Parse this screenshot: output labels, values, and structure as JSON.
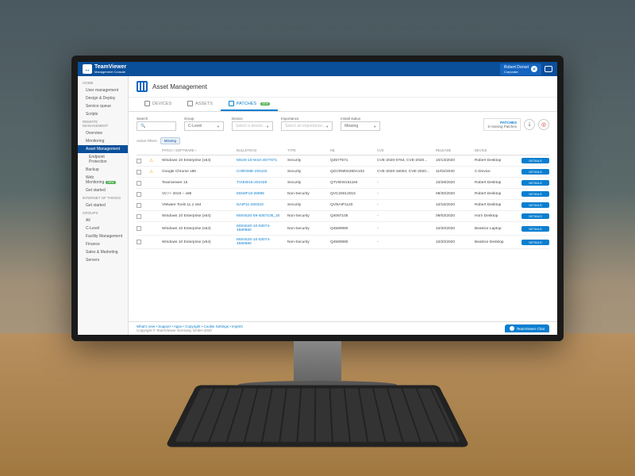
{
  "brand": {
    "name": "TeamViewer",
    "subtitle": "Management Console",
    "logo_glyph": "↔"
  },
  "user": {
    "name": "Robert Dorset",
    "tier": "Corporate"
  },
  "sidebar": {
    "sections": [
      {
        "title": "HOME",
        "items": [
          {
            "label": "User management"
          },
          {
            "label": "Design & Deploy"
          },
          {
            "label": "Service queue"
          },
          {
            "label": "Scripts"
          }
        ]
      },
      {
        "title": "REMOTE MANAGEMENT",
        "items": [
          {
            "label": "Overview"
          },
          {
            "label": "Monitoring"
          },
          {
            "label": "Asset Management",
            "active": true
          },
          {
            "label": "Endpoint Protection",
            "sub": true
          },
          {
            "label": "Backup"
          },
          {
            "label": "Web Monitoring",
            "badge": "NEW"
          },
          {
            "label": "Get started"
          }
        ]
      },
      {
        "title": "INTERNET OF THINGS",
        "items": [
          {
            "label": "Get started"
          }
        ]
      },
      {
        "title": "GROUPS",
        "items": [
          {
            "label": "All"
          },
          {
            "label": "C-Level"
          },
          {
            "label": "Facility Management"
          },
          {
            "label": "Finance"
          },
          {
            "label": "Sales & Marketing"
          },
          {
            "label": "Servers"
          }
        ]
      }
    ]
  },
  "page": {
    "title": "Asset Management"
  },
  "tabs": [
    {
      "label": "DEVICES"
    },
    {
      "label": "ASSETS"
    },
    {
      "label": "PATCHES",
      "active": true,
      "badge": "NEW"
    }
  ],
  "filters": {
    "search": {
      "label": "Search",
      "placeholder": ""
    },
    "group": {
      "label": "Group",
      "value": "C-Level"
    },
    "device": {
      "label": "Device",
      "placeholder": "Select a device..."
    },
    "importance": {
      "label": "Importance",
      "placeholder": "Select an importance..."
    },
    "install": {
      "label": "Install status",
      "value": "Missing"
    }
  },
  "patches_summary": {
    "title": "PATCHES",
    "text": "8 missing Patches"
  },
  "active_filters": {
    "label": "Active Filters",
    "chip": "Missing"
  },
  "columns": [
    "",
    "",
    "PATCH / SOFTWARE",
    "BULLETIN ID",
    "TYPE",
    "KB",
    "CVE",
    "RELEASE",
    "DEVICE",
    ""
  ],
  "sort_indicator": "↑",
  "details_label": "DETAILS",
  "rows": [
    {
      "warn": true,
      "patch": "Windows 10 Enterprise (x64)",
      "bulletin": "MS20-10-W10-4577671",
      "type": "Security",
      "kb": "Q4577671",
      "cve": "CVE-2020-0764, CVE-2020...",
      "release": "10/13/2020",
      "device": "Robert Desktop"
    },
    {
      "warn": true,
      "patch": "Google Chrome x86",
      "bulletin": "CHROME-201102",
      "type": "Security",
      "kb": "QGCRM04280A103",
      "cve": "CVE-2020-16004, CVE-2020...",
      "release": "11/02/2020",
      "device": "C-Device"
    },
    {
      "warn": false,
      "patch": "Teamviewer 15",
      "bulletin": "TVIEW15-201028",
      "type": "Security",
      "kb": "QTVIEW151184",
      "cve": "-",
      "release": "10/28/2020",
      "device": "Robert Desktop"
    },
    {
      "warn": false,
      "patch": "VC++ 2015 – x86",
      "bulletin": "MSWF18-26995",
      "type": "Non-Security",
      "kb": "QVC26012015",
      "cve": "-",
      "release": "08/30/2020",
      "device": "Robert Desktop"
    },
    {
      "warn": false,
      "patch": "VMware Tools 11.1 x64",
      "bulletin": "NAIP11-200319",
      "type": "Security",
      "kb": "QVNAIP1120",
      "cve": "-",
      "release": "10/16/2020",
      "device": "Robert Desktop"
    },
    {
      "warn": false,
      "patch": "Windows 10 Enterprise (x64)",
      "bulletin": "MSNS20-09-4087105_20",
      "type": "Non-Security",
      "kb": "Q4087105",
      "cve": "-",
      "release": "09/03/2020",
      "device": "Horn Desktop"
    },
    {
      "warn": false,
      "patch": "Windows 10 Enterprise (x64)",
      "bulletin": "MSNS20-10-03074-4580980",
      "type": "Non-Security",
      "kb": "Q4580980",
      "cve": "-",
      "release": "10/20/2020",
      "device": "Beatrice Laptop"
    },
    {
      "warn": false,
      "patch": "Windows 10 Enterprise (x64)",
      "bulletin": "MSNS20-10-03074-4580980",
      "type": "Non-Security",
      "kb": "Q4580980",
      "cve": "-",
      "release": "10/20/2020",
      "device": "Beatrice Desktop"
    }
  ],
  "footer": {
    "links": "What's new • Support • Apps • Copyright • Cookie Settings • Imprint",
    "copyright": "Copyright © TeamViewer Germany GmbH 2020",
    "chat": "TeamViewer Chat"
  }
}
